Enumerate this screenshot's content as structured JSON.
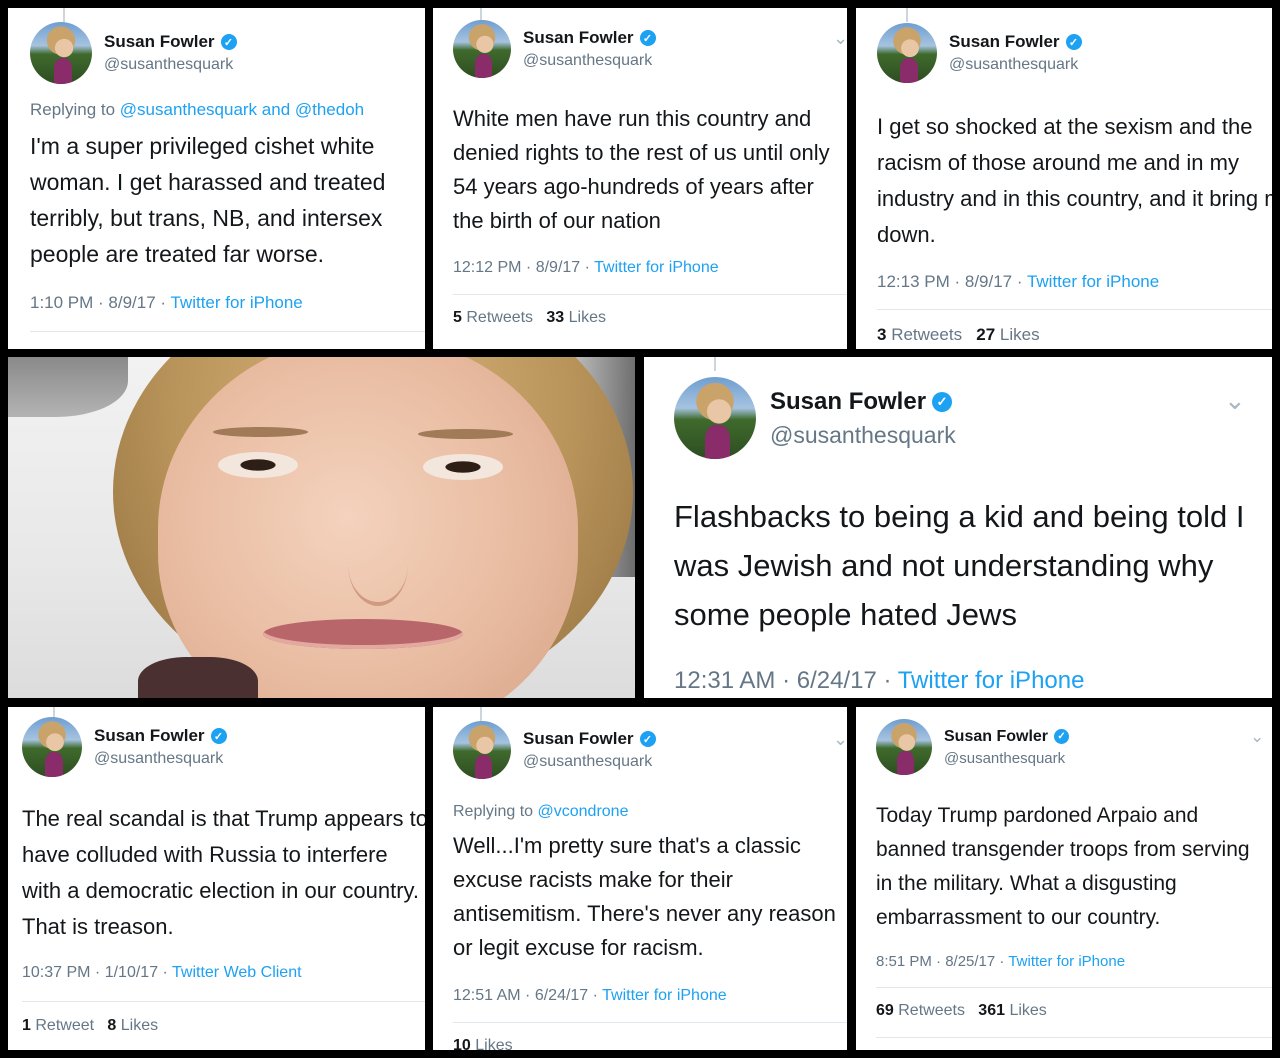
{
  "user": {
    "name": "Susan Fowler",
    "handle": "@susanthesquark",
    "verified_icon": "verified-badge-icon",
    "badge_glyph": "✓",
    "chevron_glyph": "⌄"
  },
  "colors": {
    "link": "#1da1f2",
    "muted": "#657786",
    "text": "#14171a",
    "background": "#000000"
  },
  "photo": {
    "description_icon": "portrait-photo"
  },
  "tweets": [
    {
      "replying_prefix": "Replying to ",
      "mention1": "@susanthesquark",
      "mention_sep": " and ",
      "mention2": "@thedoh",
      "text": "I'm a super privileged cishet white woman. I get harassed and treated terribly, but trans, NB, and intersex people are treated far worse.",
      "time": "1:10 PM · 8/9/17 · ",
      "source": "Twitter for iPhone"
    },
    {
      "text": "White men have run this country and denied rights to the rest of us until only 54 years ago-hundreds of years after the birth of our nation",
      "time": "12:12 PM · 8/9/17 · ",
      "source": "Twitter for iPhone",
      "retweets": "5",
      "retweets_label": "Retweets",
      "likes": "33",
      "likes_label": "Likes"
    },
    {
      "text": "I get so shocked at the sexism and the racism of those around me and in my industry and in this country, and it bring me down.",
      "time": "12:13 PM · 8/9/17 · ",
      "source": "Twitter for iPhone",
      "retweets": "3",
      "retweets_label": "Retweets",
      "likes": "27",
      "likes_label": "Likes"
    },
    {
      "text": "Flashbacks to being a kid and being told I was Jewish and not understanding why some people hated Jews",
      "time": "12:31 AM · 6/24/17 · ",
      "source": "Twitter for iPhone"
    },
    {
      "text": "The real scandal is that Trump appears to have colluded with Russia to interfere with a democratic election in our country. That is treason.",
      "time": "10:37 PM · 1/10/17 · ",
      "source": "Twitter Web Client",
      "retweets": "1",
      "retweets_label": "Retweet",
      "likes": "8",
      "likes_label": "Likes"
    },
    {
      "replying_prefix": "Replying to ",
      "mention1": "@vcondrone",
      "text": "Well...I'm pretty sure that's a classic excuse racists make for their antisemitism. There's never any reason or legit excuse for racism.",
      "time": "12:51 AM · 6/24/17 · ",
      "source": "Twitter for iPhone",
      "likes": "10",
      "likes_label": "Likes"
    },
    {
      "text": "Today Trump pardoned Arpaio and banned transgender troops from serving in the military. What a disgusting embarrassment to our country.",
      "time": "8:51 PM · 8/25/17 · ",
      "source": "Twitter for iPhone",
      "retweets": "69",
      "retweets_label": "Retweets",
      "likes": "361",
      "likes_label": "Likes"
    }
  ]
}
